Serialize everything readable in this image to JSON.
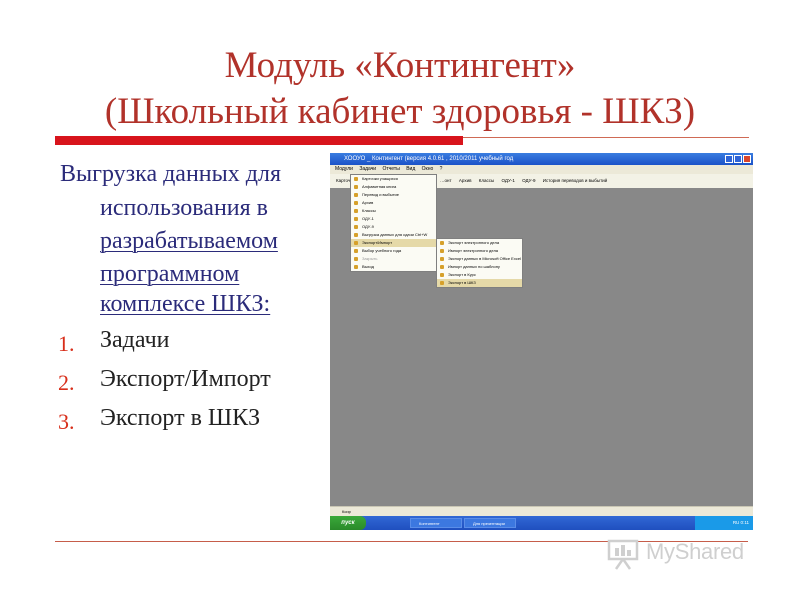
{
  "slide": {
    "title_line1": "Модуль «Контингент»",
    "title_line2": "(Школьный кабинет здоровья - ШКЗ)",
    "intro_lines": [
      "Выгрузка данных для",
      "использования в",
      "разрабатываемом",
      "программном",
      "комплексе  ШКЗ:"
    ],
    "list": [
      {
        "num": "1.",
        "text": "Задачи"
      },
      {
        "num": "2.",
        "text": "Экспорт/Импорт"
      },
      {
        "num": "3.",
        "text": "Экспорт в ШКЗ"
      }
    ],
    "colors": {
      "title": "#b1322a",
      "rule": "#d8141c",
      "list_number": "#d82e1a",
      "intro": "#2b2b7a"
    }
  },
  "screenshot": {
    "window_title": "ХООУО _ Контингент (версия 4.0.61 , 2010/2011 учебный год",
    "menubar": [
      "Модули",
      "Задачи",
      "Отчеты",
      "Вид",
      "Окно",
      "?"
    ],
    "toolbar": [
      "Карточки",
      "…онт",
      "Архив",
      "Классы",
      "ОДУ-1",
      "ОДУ-9",
      "История переводов и выбытий"
    ],
    "task_menu": [
      "Карточки учащихся",
      "Алфавитная книга",
      "Перевод и выбытие",
      "Архив",
      "Классы",
      "ОДУ-1",
      "ОДУ-9",
      "Выгрузка данных для сдачи  Ctrl+W",
      "Экспорт/Импорт",
      "Выбор учебного года",
      "Закрыть",
      "Выход"
    ],
    "export_menu": [
      "Экспорт электронного дела",
      "Импорт электронного дела",
      "Экспорт данных в Microsoft Office Excel",
      "Импорт данных по шаблону",
      "Экспорт в Курс",
      "Экспорт в ШКЗ"
    ],
    "status_text": "Ксир",
    "taskbar": {
      "start_label": "пуск",
      "buttons": [
        "Контингент",
        "Для презентации"
      ],
      "tray": "RU  0:11"
    }
  },
  "watermark": {
    "text": "MyShared"
  }
}
